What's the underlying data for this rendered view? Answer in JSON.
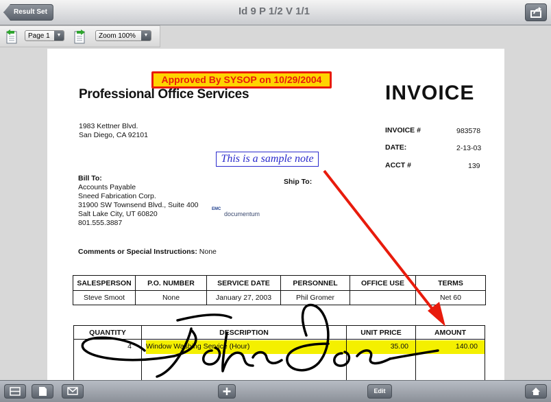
{
  "topbar": {
    "back_label": "Result Set",
    "title": "Id  9 P 1/2 V 1/1"
  },
  "toolbar": {
    "page_select": "Page 1",
    "zoom_select": "Zoom 100%"
  },
  "document": {
    "stamp": "Approved By SYSOP on 10/29/2004",
    "company": "Professional Office Services",
    "heading": "INVOICE",
    "address_line1": "1983 Kettner Blvd.",
    "address_line2": "San Diego, CA  92101",
    "invoice_label": "INVOICE #",
    "invoice_value": "983578",
    "date_label": "DATE:",
    "date_value": "2-13-03",
    "acct_label": "ACCT #",
    "acct_value": "139",
    "note": "This is a sample note",
    "bill_to_label": "Bill To:",
    "bill_to_lines": [
      "Accounts Payable",
      "Sneed Fabrication Corp.",
      "31900 SW Townsend Blvd., Suite 400",
      "Salt Lake City, UT  60820",
      "801.555.3887"
    ],
    "ship_to_label": "Ship To:",
    "logo_emc": "EMC",
    "logo_text": "documentum",
    "comments_label": "Comments or Special Instructions:",
    "comments_value": "None",
    "table1_headers": [
      "SALESPERSON",
      "P.O. NUMBER",
      "SERVICE DATE",
      "PERSONNEL",
      "OFFICE USE",
      "TERMS"
    ],
    "table1_row": [
      "Steve Smoot",
      "None",
      "January 27, 2003",
      "Phil Gromer",
      "",
      "Net 60"
    ],
    "table2_headers": [
      "QUANTITY",
      "DESCRIPTION",
      "UNIT PRICE",
      "AMOUNT"
    ],
    "table2_row": [
      "4",
      "Window Washing Service (Hour)",
      "35.00",
      "140.00"
    ],
    "signature": "John Doe"
  },
  "bottombar": {
    "edit_label": "Edit"
  },
  "colors": {
    "stamp_fill": "#ffd400",
    "stamp_border": "#e81b0c",
    "note_color": "#2a2acc",
    "highlight": "#f4f000",
    "arrow": "#e81b0c"
  }
}
